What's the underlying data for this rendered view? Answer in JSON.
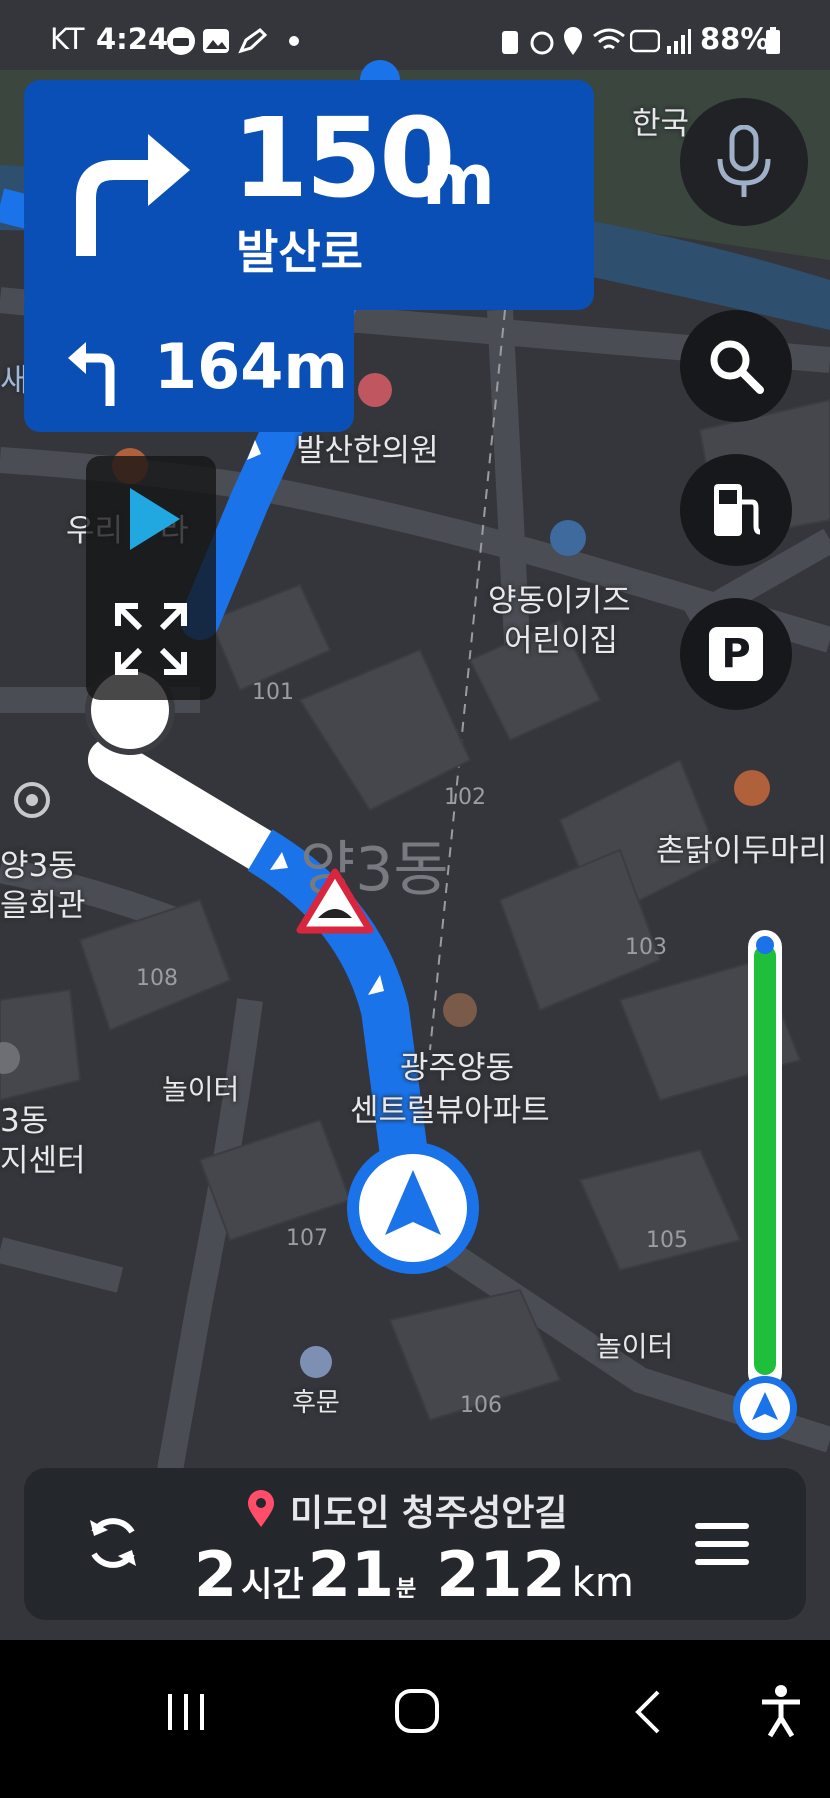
{
  "status_bar": {
    "carrier": "KT",
    "time": "4:24",
    "battery": "88%",
    "left_icons": [
      "car-icon",
      "gallery-icon",
      "pen-icon",
      "dot-icon"
    ],
    "right_icons": [
      "battery-saver-icon",
      "alarm-icon",
      "location-icon",
      "wifi-icon",
      "hd-icon",
      "signal-icon",
      "battery-icon"
    ]
  },
  "guidance": {
    "primary_distance": "150",
    "primary_unit": "m",
    "primary_road": "발산로",
    "primary_turn": "turn-right-icon",
    "secondary_distance": "164m",
    "secondary_turn": "turn-left-icon"
  },
  "map_labels": {
    "korea_partial": "한국",
    "sae_partial": "새",
    "clinic": "발산한의원",
    "restaurant_partial": "우리",
    "restaurant_partial_b": "라",
    "kids": "양동이키즈",
    "kids2": "어린이집",
    "dong3": "양3동",
    "dong3_left": "양3동",
    "hall_left": "을회관",
    "chicken": "촌닭이두마리",
    "apt": "광주양동",
    "apt2": "센트럴뷰아파트",
    "playground1": "놀이터",
    "playground2": "놀이터",
    "dong3b": "3동",
    "center": "지센터",
    "back_gate": "후문"
  },
  "building_numbers": [
    "101",
    "102",
    "103",
    "105",
    "106",
    "107",
    "108"
  ],
  "route_progress": 0.03,
  "colors": {
    "nav_blue": "#0a4fb6",
    "route_blue": "#1a73e8",
    "progress_green": "#1fbf3c",
    "pin_red": "#ff4d6a"
  },
  "side_buttons": [
    "mic-icon",
    "search-icon",
    "gas-station-icon",
    "parking-icon"
  ],
  "parking_label": "P",
  "bottom": {
    "destination": "미도인 청주성안길",
    "hours": "2",
    "hours_unit": "시간",
    "minutes": "21",
    "minutes_unit": "분",
    "distance": "212",
    "distance_unit": "km"
  },
  "overlay": {
    "play_icon": "play-icon",
    "expand_icon": "expand-icon"
  },
  "navigation_bar": [
    "recent-apps-icon",
    "home-icon",
    "back-icon",
    "accessibility-icon"
  ]
}
